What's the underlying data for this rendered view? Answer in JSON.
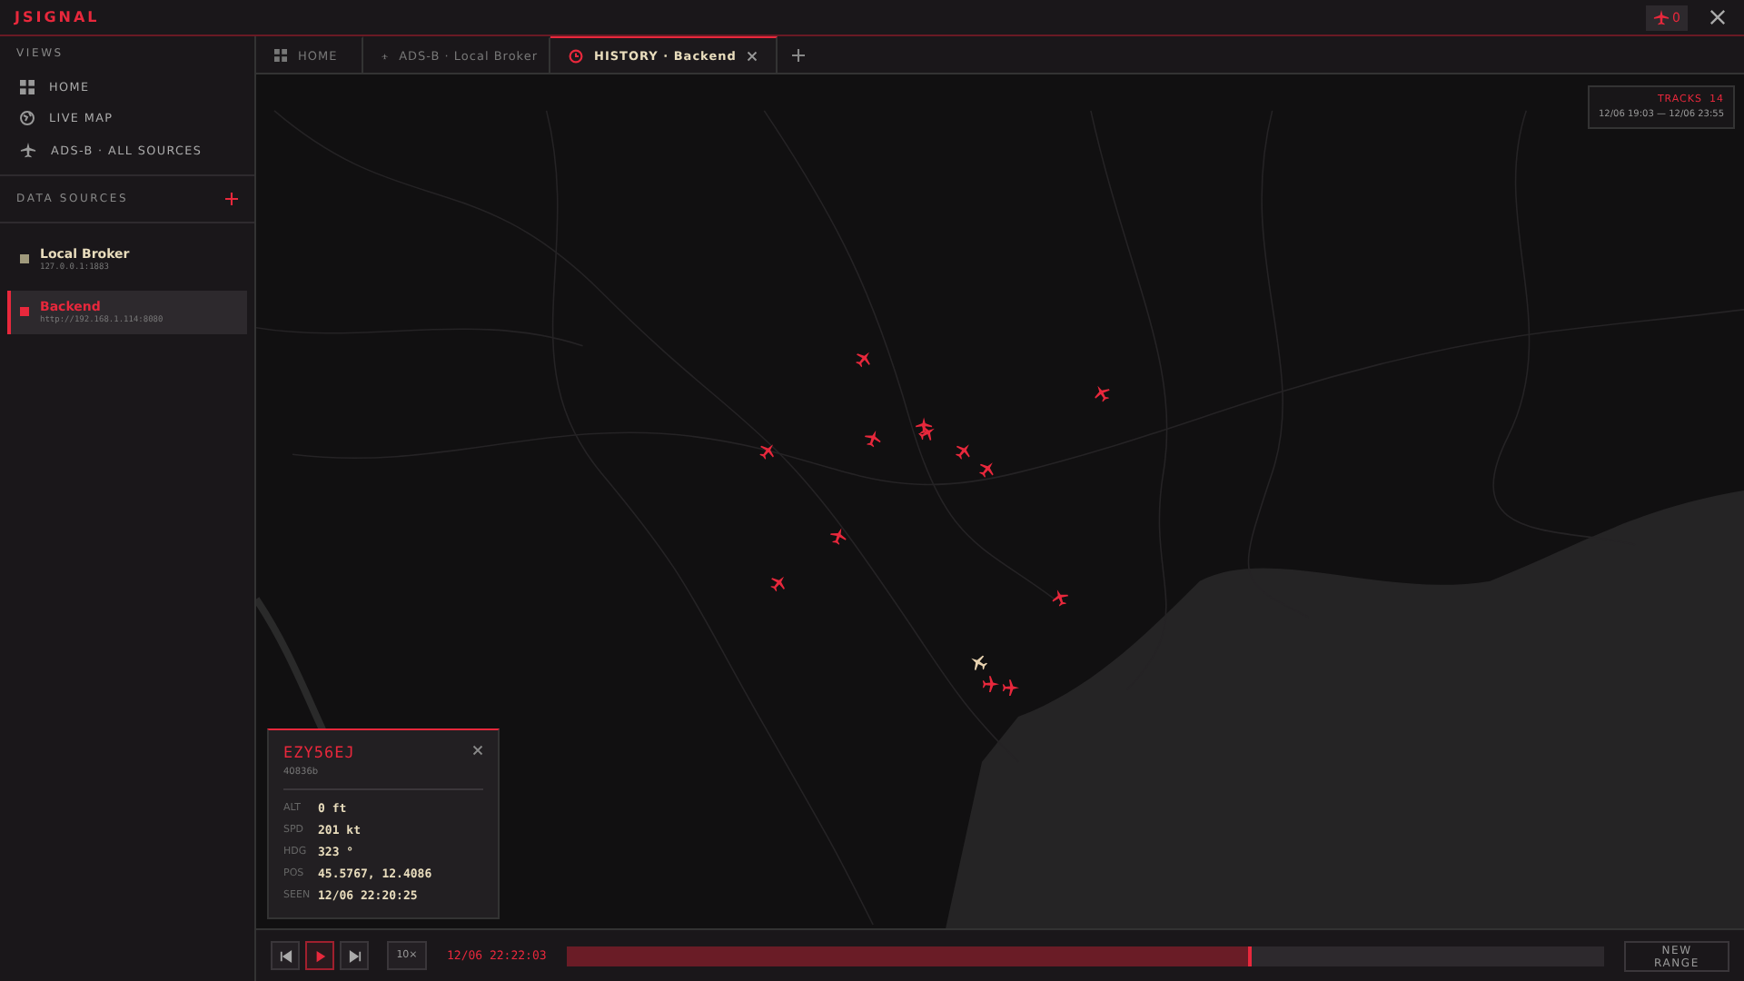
{
  "app": {
    "logo": "JSIGNAL",
    "alert_count": "0"
  },
  "sidebar": {
    "views_title": "VIEWS",
    "views": [
      {
        "label": "HOME",
        "selected": false
      },
      {
        "label": "LIVE MAP",
        "selected": false
      },
      {
        "label": "ADS-B · ALL SOURCES",
        "selected": false
      }
    ],
    "sources_title": "DATA SOURCES",
    "sources": [
      {
        "name": "Local Broker",
        "address": "127.0.0.1:1883",
        "selected": false
      },
      {
        "name": "Backend",
        "address": "http://192.168.1.114:8080",
        "selected": true
      }
    ]
  },
  "tabs": [
    {
      "label": "HOME",
      "selected": false
    },
    {
      "label": "ADS-B · Local Broker",
      "selected": false
    },
    {
      "label": "HISTORY · Backend",
      "selected": true
    }
  ],
  "tracks": {
    "label": "TRACKS",
    "count": "14",
    "range": "12/06 19:03 — 12/06 23:55"
  },
  "popup": {
    "callsign": "EZY56EJ",
    "hex": "40836b",
    "fields": [
      {
        "label": "ALT",
        "value": "0 ft"
      },
      {
        "label": "SPD",
        "value": "201 kt"
      },
      {
        "label": "HDG",
        "value": "323 °"
      },
      {
        "label": "POS",
        "value": "45.5767, 12.4086"
      },
      {
        "label": "SEEN",
        "value": "12/06 22:20:25"
      }
    ]
  },
  "playback": {
    "speed": "10×",
    "time": "12/06 22:22:03",
    "level": 0.66,
    "playing": true,
    "new_range": "NEW RANGE"
  }
}
